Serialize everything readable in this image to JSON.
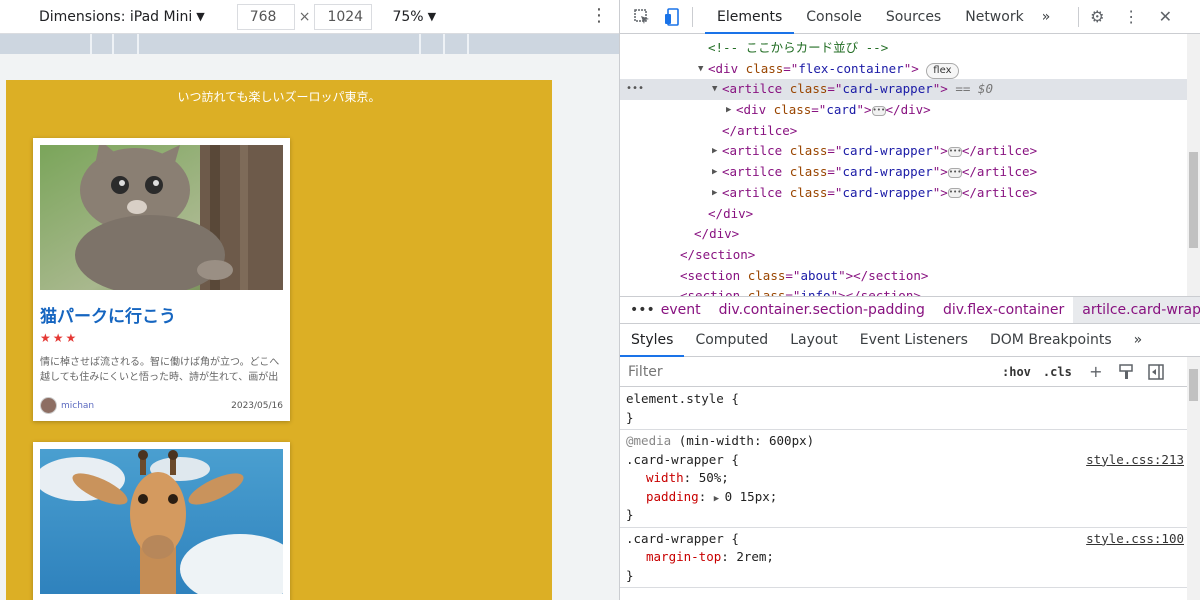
{
  "device_toolbar": {
    "dimensions_label": "Dimensions: iPad Mini",
    "width": "768",
    "height": "1024",
    "times": "×",
    "zoom": "75%"
  },
  "page": {
    "tagline": "いつ訪れても楽しいズーロッパ東京。",
    "cards": [
      {
        "title": "猫パークに行こう",
        "stars": "★★★",
        "excerpt": "情に棹させば流される。智に働けば角が立つ。どこへ越しても住みにくいと悟った時、詩が生れて、画が出",
        "author": "michan",
        "date": "2023/05/16"
      }
    ]
  },
  "devtools": {
    "tabs": [
      "Elements",
      "Console",
      "Sources",
      "Network"
    ],
    "more_tabs": "»",
    "dom": {
      "comment": "<!-- ここからカード並び -->",
      "flex_badge": "flex",
      "selected_suffix": "== $0",
      "lines": {
        "div_flex_open_tag": "div",
        "class_attr": "class",
        "flex_container": "flex-container",
        "artilce": "artilce",
        "card_wrapper": "card-wrapper",
        "div": "div",
        "card": "card",
        "section": "section",
        "about": "about",
        "info": "info"
      }
    },
    "breadcrumbs": [
      "event",
      "div.container.section-padding",
      "div.flex-container",
      "artilce.card-wrapper"
    ],
    "breadcrumbs_more": "…",
    "subtabs": [
      "Styles",
      "Computed",
      "Layout",
      "Event Listeners",
      "DOM Breakpoints"
    ],
    "subtabs_more": "»",
    "filter_placeholder": "Filter",
    "hov": ":hov",
    "cls": ".cls",
    "styles": {
      "element_style": "element.style {",
      "close": "}",
      "media": "@media",
      "media_query": "(min-width: 600px)",
      "rule1_selector": ".card-wrapper {",
      "rule1_source": "style.css:213",
      "rule1_props": [
        {
          "name": "width",
          "value": "50%;"
        },
        {
          "name": "padding",
          "value": "0 15px;"
        }
      ],
      "rule2_selector": ".card-wrapper {",
      "rule2_source": "style.css:100",
      "rule2_props": [
        {
          "name": "margin-top",
          "value": "2rem;"
        }
      ]
    }
  }
}
